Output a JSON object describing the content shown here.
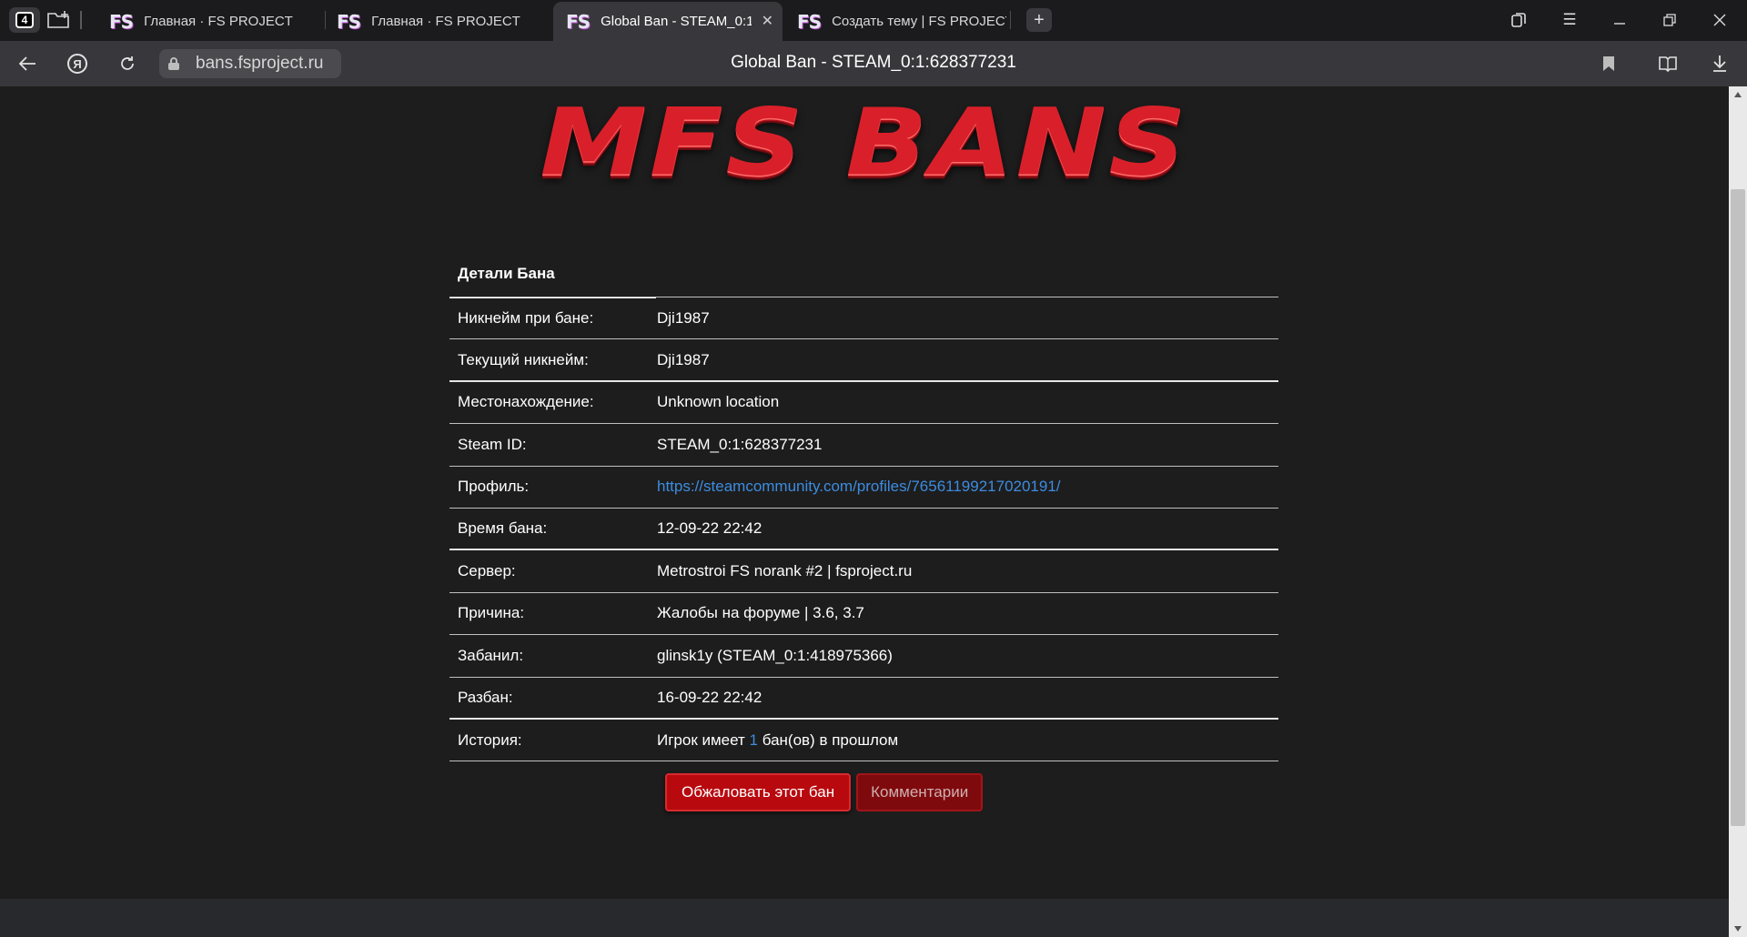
{
  "browser": {
    "tab_count": "4",
    "tabs": [
      {
        "favicon": "FS",
        "title": "Главная · FS PROJECT",
        "active": false
      },
      {
        "favicon": "FS",
        "title": "Главная · FS PROJECT",
        "active": false
      },
      {
        "favicon": "FS",
        "title": "Global Ban - STEAM_0:1",
        "active": true
      },
      {
        "favicon": "FS",
        "title": "Создать тему | FS PROJECT",
        "active": false
      }
    ],
    "url": "bans.fsproject.ru",
    "page_title": "Global Ban - STEAM_0:1:628377231",
    "icons": {
      "back": "back-arrow-icon",
      "yandex": "yandex-icon",
      "reload": "reload-icon",
      "lock": "lock-icon",
      "bookmark": "bookmark-icon",
      "reader": "reader-mode-icon",
      "download": "download-icon"
    }
  },
  "page": {
    "logo": "MFS BANS",
    "details": {
      "header": "Детали Бана",
      "rows": [
        {
          "label": "Никнейм при бане:",
          "value": "Dji1987"
        },
        {
          "label": "Текущий никнейм:",
          "value": "Dji1987"
        },
        {
          "label": "Местонахождение:",
          "value": "Unknown location"
        },
        {
          "label": "Steam ID:",
          "value": "STEAM_0:1:628377231"
        },
        {
          "label": "Профиль:",
          "value": "https://steamcommunity.com/profiles/76561199217020191/"
        },
        {
          "label": "Время бана:",
          "value": "12-09-22 22:42"
        },
        {
          "label": "Сервер:",
          "value": "Metrostroi FS norank #2 | fsproject.ru"
        },
        {
          "label": "Причина:",
          "value": "Жалобы на форуме | 3.6, 3.7"
        },
        {
          "label": "Забанил:",
          "value": "glinsk1y (STEAM_0:1:418975366)"
        },
        {
          "label": "Разбан:",
          "value": "16-09-22 22:42"
        }
      ],
      "history": {
        "label": "История:",
        "prefix": "Игрок имеет ",
        "count": "1",
        "suffix": " бан(ов) в прошлом"
      }
    },
    "buttons": {
      "appeal": "Обжаловать этот бан",
      "comments": "Комментарии"
    },
    "colors": {
      "link": "#3d8ce0",
      "appeal_bg": "#b8090f",
      "logo": "#d9202a"
    }
  }
}
